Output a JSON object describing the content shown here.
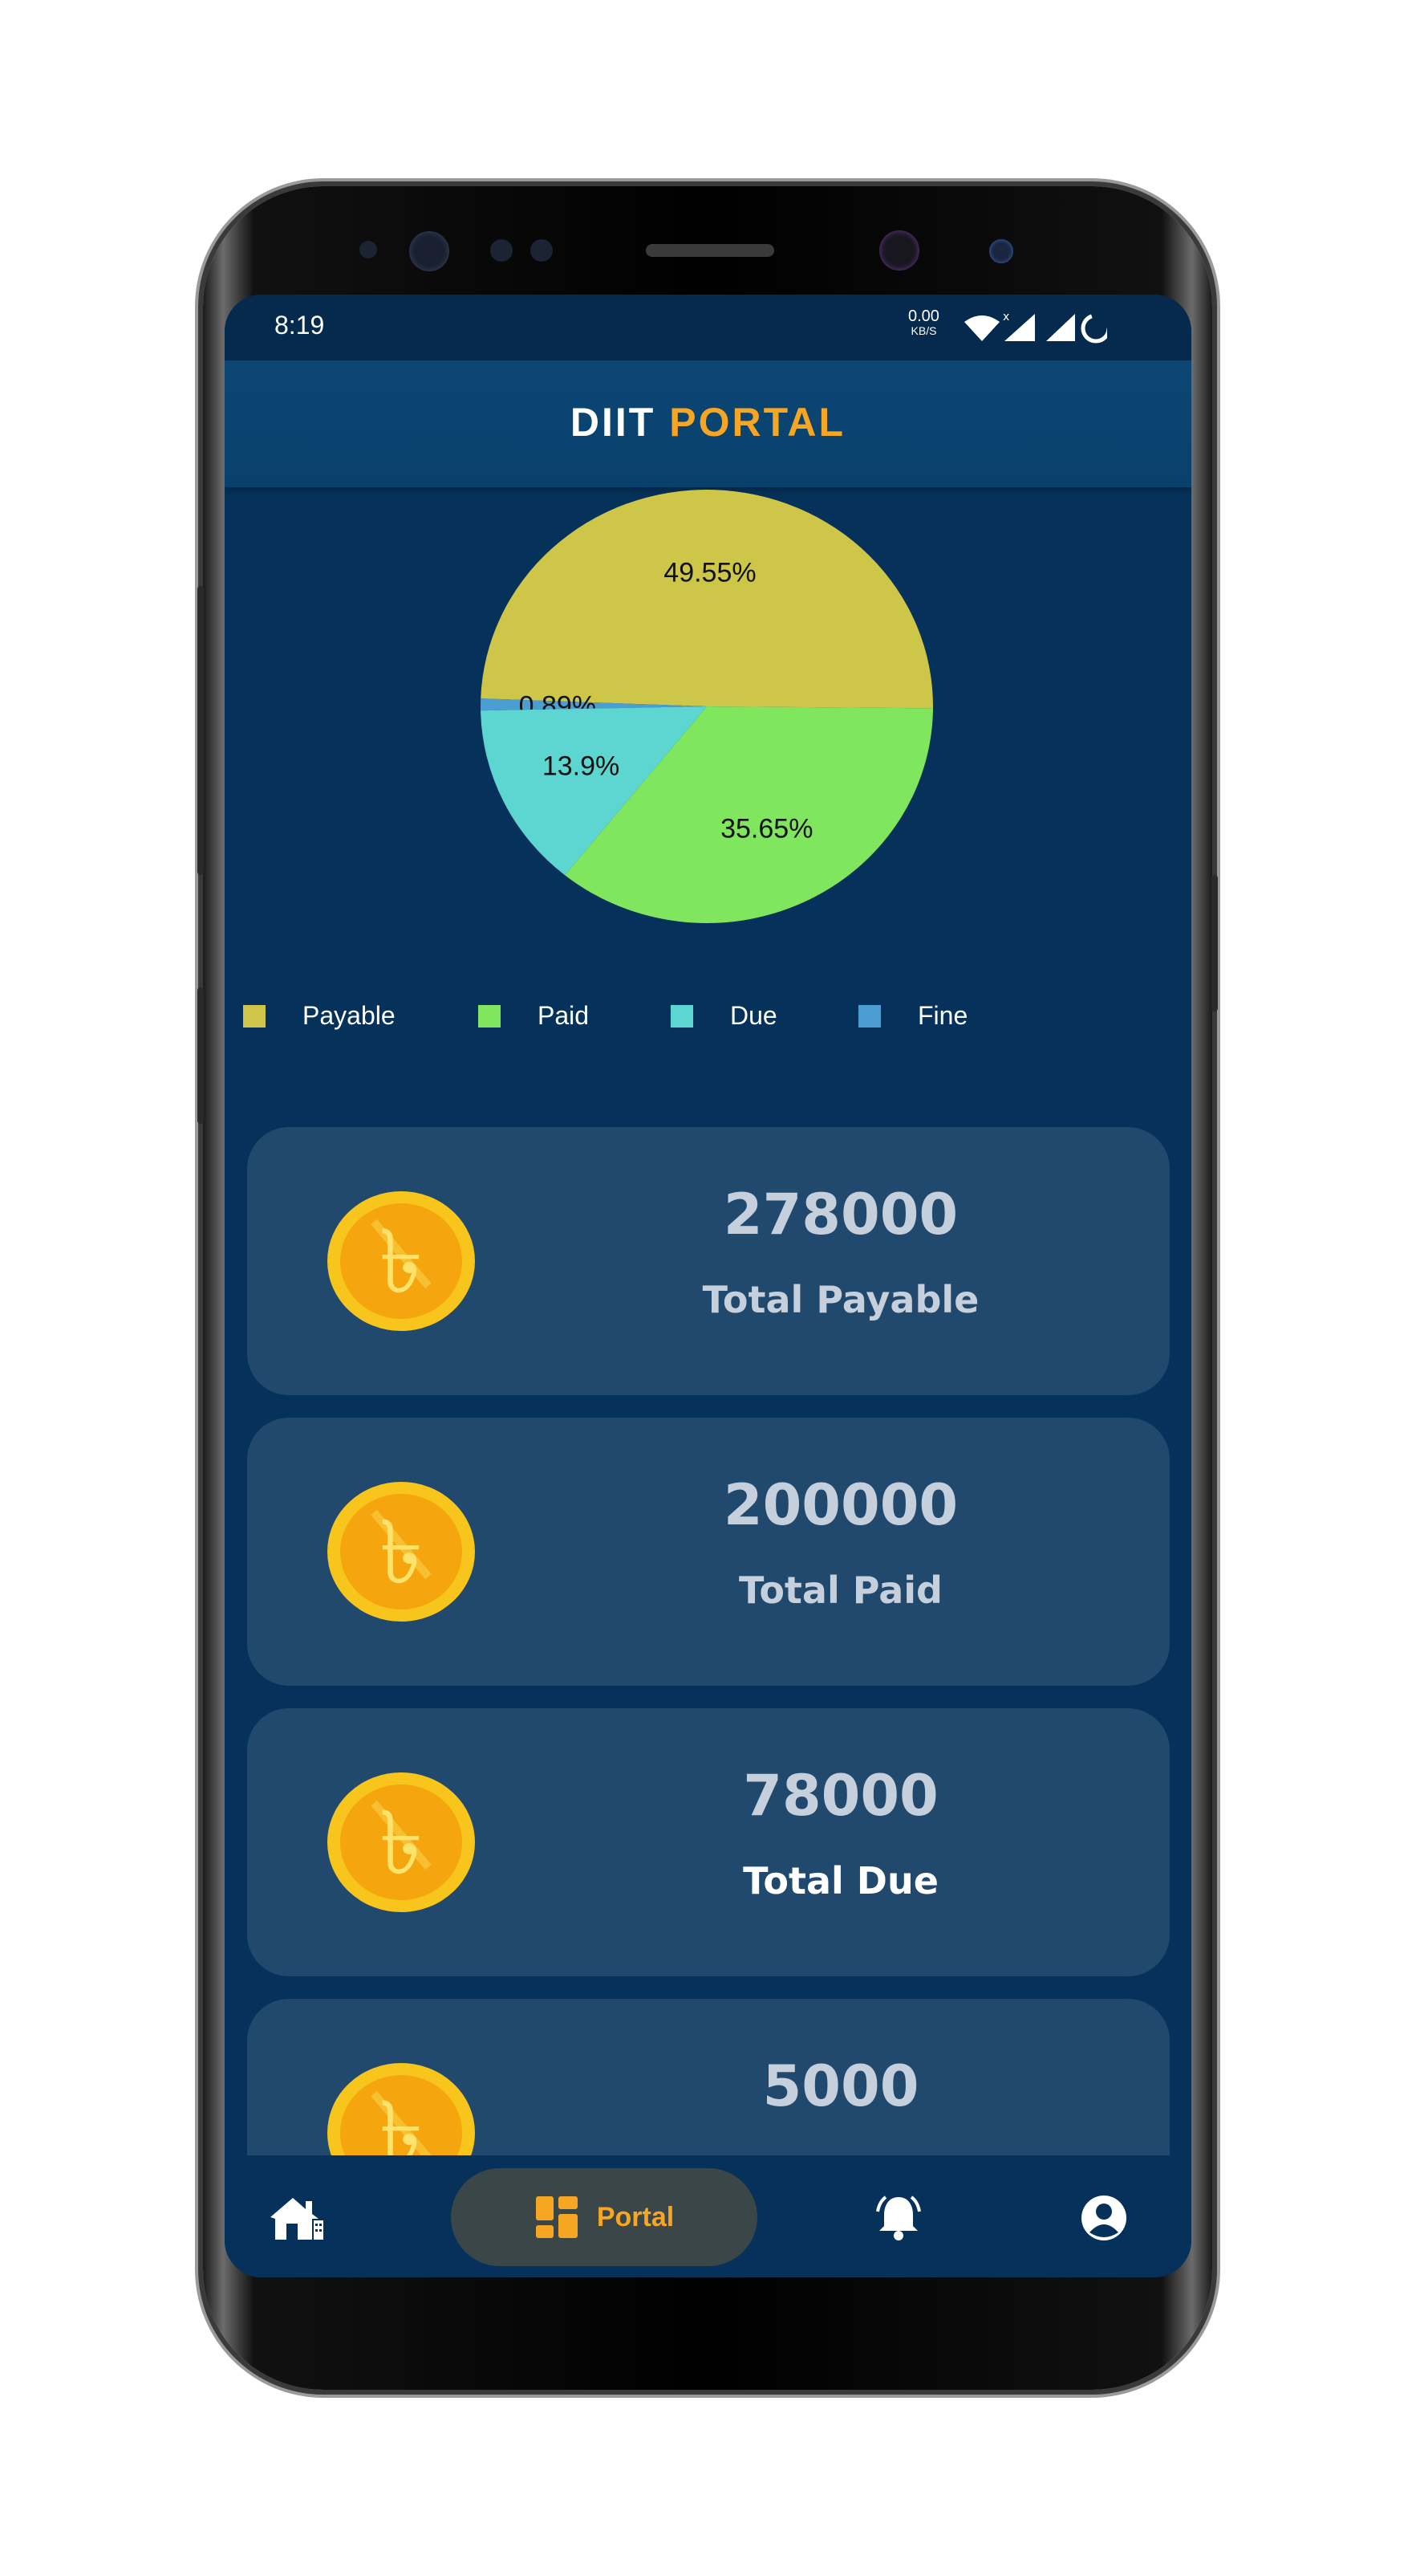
{
  "status_bar": {
    "time": "8:19",
    "net_speed": "0.00",
    "net_unit": "KB/S"
  },
  "app_bar": {
    "title_part1": "DIIT",
    "title_part2": "PORTAL"
  },
  "chart_data": {
    "type": "pie",
    "categories": [
      "Payable",
      "Paid",
      "Due",
      "Fine"
    ],
    "values": [
      49.55,
      35.65,
      13.9,
      0.89
    ],
    "labels": [
      "49.55%",
      "35.65%",
      "13.9%",
      "0.89%"
    ],
    "colors": [
      "#cdc648",
      "#80e65e",
      "#5dd6d2",
      "#4b9ed2"
    ],
    "legend_placement": "bottom"
  },
  "legend": {
    "items": [
      {
        "label": "Payable",
        "color": "#cdc648"
      },
      {
        "label": "Paid",
        "color": "#80e65e"
      },
      {
        "label": "Due",
        "color": "#5dd6d2"
      },
      {
        "label": "Fine",
        "color": "#4b9ed2"
      }
    ]
  },
  "cards": [
    {
      "amount": "278000",
      "label": "Total Payable",
      "icon": "taka-coin-icon"
    },
    {
      "amount": "200000",
      "label": "Total Paid",
      "icon": "taka-coin-icon"
    },
    {
      "amount": "78000",
      "label": "Total Due",
      "icon": "taka-coin-icon"
    },
    {
      "amount": "5000",
      "label": "",
      "icon": "taka-coin-icon"
    }
  ],
  "bottom_nav": {
    "items": [
      {
        "icon": "home-icon"
      },
      {
        "icon": "portal-dashboard-icon",
        "label": "Portal",
        "active": true
      },
      {
        "icon": "notification-bell-icon"
      },
      {
        "icon": "profile-icon"
      }
    ],
    "active_color": "#f6a623"
  }
}
